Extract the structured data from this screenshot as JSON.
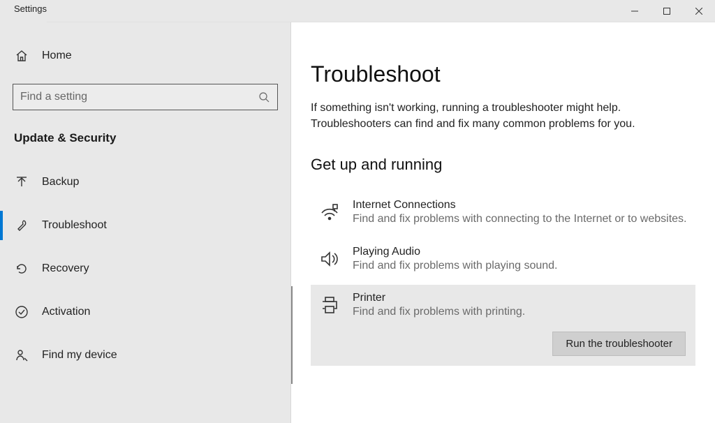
{
  "window": {
    "app_title": "Settings"
  },
  "sidebar": {
    "home_label": "Home",
    "search_placeholder": "Find a setting",
    "category_label": "Update & Security",
    "items": [
      {
        "label": "Backup",
        "icon": "backup-icon"
      },
      {
        "label": "Troubleshoot",
        "icon": "troubleshoot-icon"
      },
      {
        "label": "Recovery",
        "icon": "recovery-icon"
      },
      {
        "label": "Activation",
        "icon": "activation-icon"
      },
      {
        "label": "Find my device",
        "icon": "find-device-icon"
      }
    ]
  },
  "content": {
    "heading": "Troubleshoot",
    "description": "If something isn't working, running a troubleshooter might help. Troubleshooters can find and fix many common problems for you.",
    "section_heading": "Get up and running",
    "troubleshooters": [
      {
        "title": "Internet Connections",
        "desc": "Find and fix problems with connecting to the Internet or to websites.",
        "icon": "wifi-icon"
      },
      {
        "title": "Playing Audio",
        "desc": "Find and fix problems with playing sound.",
        "icon": "audio-icon"
      },
      {
        "title": "Printer",
        "desc": "Find and fix problems with printing.",
        "icon": "printer-icon"
      }
    ],
    "run_button_label": "Run the troubleshooter"
  }
}
